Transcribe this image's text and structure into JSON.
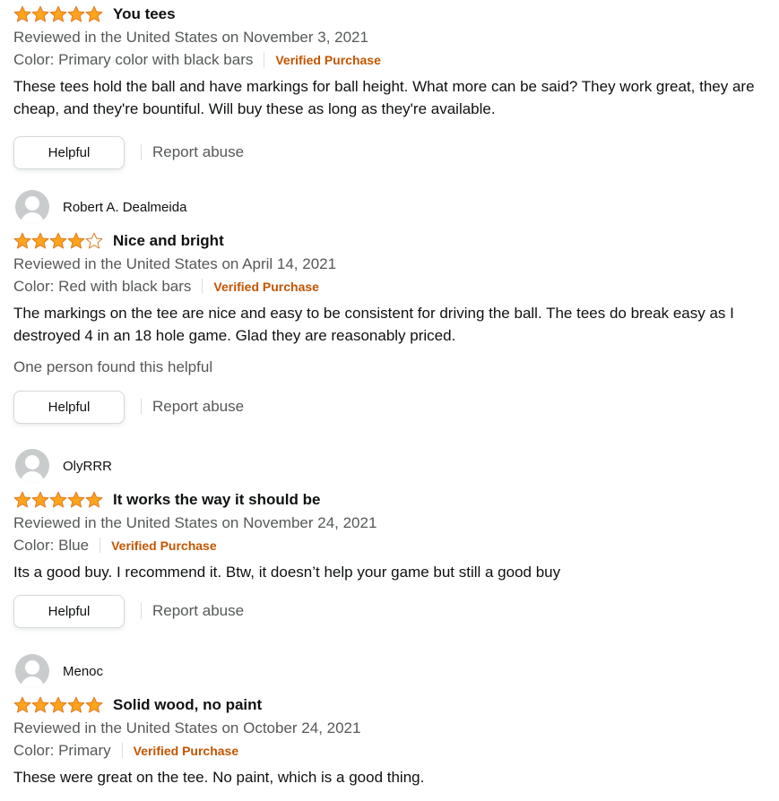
{
  "colors": {
    "star": "#ffa41c",
    "star_outline": "#de7921",
    "verified": "#c45500",
    "secondary_text": "#565959"
  },
  "reviews": [
    {
      "reviewer": "",
      "rating": 5,
      "title": "You tees",
      "date": "Reviewed in the United States on November 3, 2021",
      "color": "Color: Primary color with black bars",
      "verified": "Verified Purchase",
      "body": "These tees hold the ball and have markings for ball height. What more can be said? They work great, they are cheap, and they're bountiful. Will buy these as long as they're available.",
      "helpful_count": "",
      "helpful_label": "Helpful",
      "report_label": "Report abuse"
    },
    {
      "reviewer": "Robert A. Dealmeida",
      "rating": 4,
      "title": "Nice and bright",
      "date": "Reviewed in the United States on April 14, 2021",
      "color": "Color: Red with black bars",
      "verified": "Verified Purchase",
      "body": "The markings on the tee are nice and easy to be consistent for driving the ball. The tees do break easy as I destroyed 4 in an 18 hole game. Glad they are reasonably priced.",
      "helpful_count": "One person found this helpful",
      "helpful_label": "Helpful",
      "report_label": "Report abuse"
    },
    {
      "reviewer": "OlyRRR",
      "rating": 5,
      "title": "It works the way it should be",
      "date": "Reviewed in the United States on November 24, 2021",
      "color": "Color: Blue",
      "verified": "Verified Purchase",
      "body": "Its a good buy. I recommend it. Btw, it doesn’t help your game but still a good buy",
      "helpful_count": "",
      "helpful_label": "Helpful",
      "report_label": "Report abuse"
    },
    {
      "reviewer": "Menoc",
      "rating": 5,
      "title": "Solid wood, no paint",
      "date": "Reviewed in the United States on October 24, 2021",
      "color": "Color: Primary",
      "verified": "Verified Purchase",
      "body": "These were great on the tee. No paint, which is a good thing.",
      "helpful_count": "",
      "helpful_label": "Helpful",
      "report_label": "Report abuse"
    }
  ]
}
